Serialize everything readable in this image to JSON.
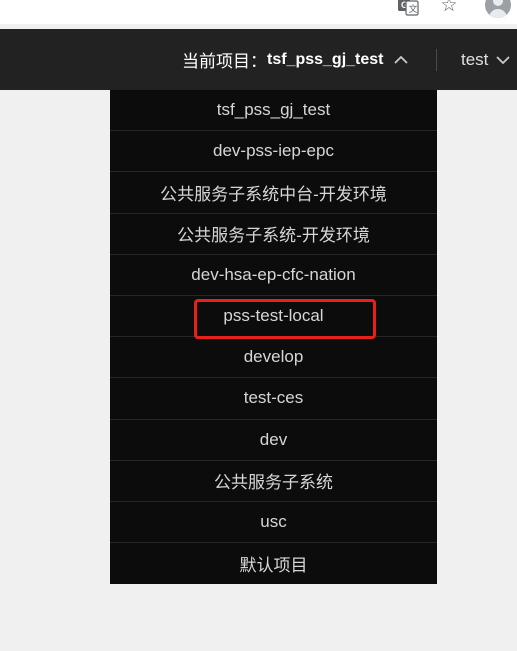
{
  "browser": {
    "icons": [
      "translate-icon",
      "star-icon",
      "profile-icon"
    ]
  },
  "header": {
    "project_prefix": "当前项目：",
    "current_project": "tsf_pss_gj_test",
    "user_name": "test"
  },
  "dropdown": {
    "items": [
      "tsf_pss_gj_test",
      "dev-pss-iep-epc",
      "公共服务子系统中台-开发环境",
      "公共服务子系统-开发环境",
      "dev-hsa-ep-cfc-nation",
      "pss-test-local",
      "develop",
      "test-ces",
      "dev",
      "公共服务子系统",
      "usc",
      "默认项目"
    ],
    "highlighted_item": "pss-test-local"
  },
  "colors": {
    "header_bg": "#222222",
    "dropdown_bg": "#0c0c0c",
    "dropdown_text": "#d6d6d6",
    "highlight": "#e8201a",
    "page_bg": "#f0f0f0"
  }
}
